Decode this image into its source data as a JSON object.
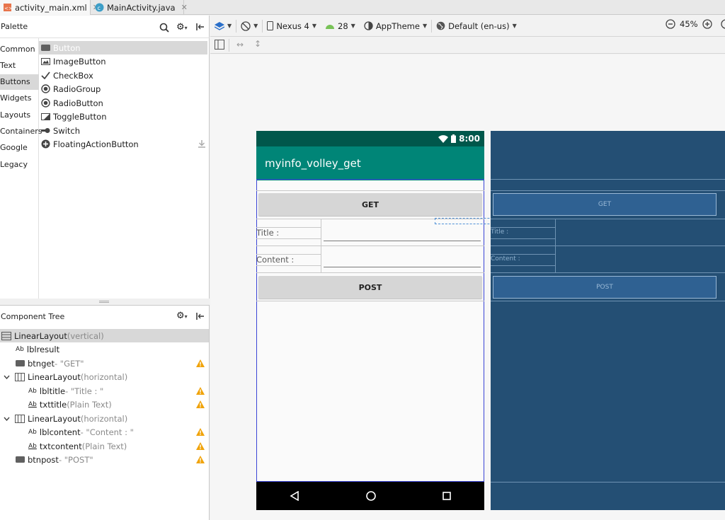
{
  "tabs": [
    {
      "label": "activity_main.xml",
      "icon": "xml-file-icon",
      "active": true
    },
    {
      "label": "MainActivity.java",
      "icon": "java-class-icon",
      "active": false
    }
  ],
  "palette": {
    "title": "Palette",
    "categories": [
      "Common",
      "Text",
      "Buttons",
      "Widgets",
      "Layouts",
      "Containers",
      "Google",
      "Legacy"
    ],
    "selected_category": "Buttons",
    "items": [
      {
        "label": "Button",
        "icon": "button-icon"
      },
      {
        "label": "ImageButton",
        "icon": "image-button-icon"
      },
      {
        "label": "CheckBox",
        "icon": "checkbox-icon"
      },
      {
        "label": "RadioGroup",
        "icon": "radio-group-icon"
      },
      {
        "label": "RadioButton",
        "icon": "radio-button-icon"
      },
      {
        "label": "ToggleButton",
        "icon": "toggle-button-icon"
      },
      {
        "label": "Switch",
        "icon": "switch-icon"
      },
      {
        "label": "FloatingActionButton",
        "icon": "fab-icon"
      }
    ]
  },
  "tree": {
    "title": "Component Tree",
    "items": [
      {
        "name": "LinearLayout",
        "hint": "(vertical)"
      },
      {
        "name": "lblresult",
        "hint": ""
      },
      {
        "name": "btnget",
        "hint": "- \"GET\""
      },
      {
        "name": "LinearLayout",
        "hint": "(horizontal)"
      },
      {
        "name": "lbltitle",
        "hint": "- \"Title : \""
      },
      {
        "name": "txttitle",
        "hint": "(Plain Text)"
      },
      {
        "name": "LinearLayout",
        "hint": "(horizontal)"
      },
      {
        "name": "lblcontent",
        "hint": "- \"Content : \""
      },
      {
        "name": "txtcontent",
        "hint": "(Plain Text)"
      },
      {
        "name": "btnpost",
        "hint": "- \"POST\""
      }
    ]
  },
  "toolbar": {
    "device": "Nexus 4",
    "api": "28",
    "theme": "AppTheme",
    "locale": "Default (en-us)",
    "zoom": "45%"
  },
  "app": {
    "time": "8:00",
    "title": "myinfo_volley_get",
    "get_label": "GET",
    "title_label": "Title :",
    "content_label": "Content :",
    "post_label": "POST"
  },
  "blueprint": {
    "get_label": "GET",
    "title_label": "Title :",
    "content_label": "Content :",
    "post_label": "POST"
  },
  "colors": {
    "status_bar": "#00574b",
    "app_bar": "#008577",
    "blueprint_bg": "#244f74",
    "warning": "#f0a30a"
  }
}
